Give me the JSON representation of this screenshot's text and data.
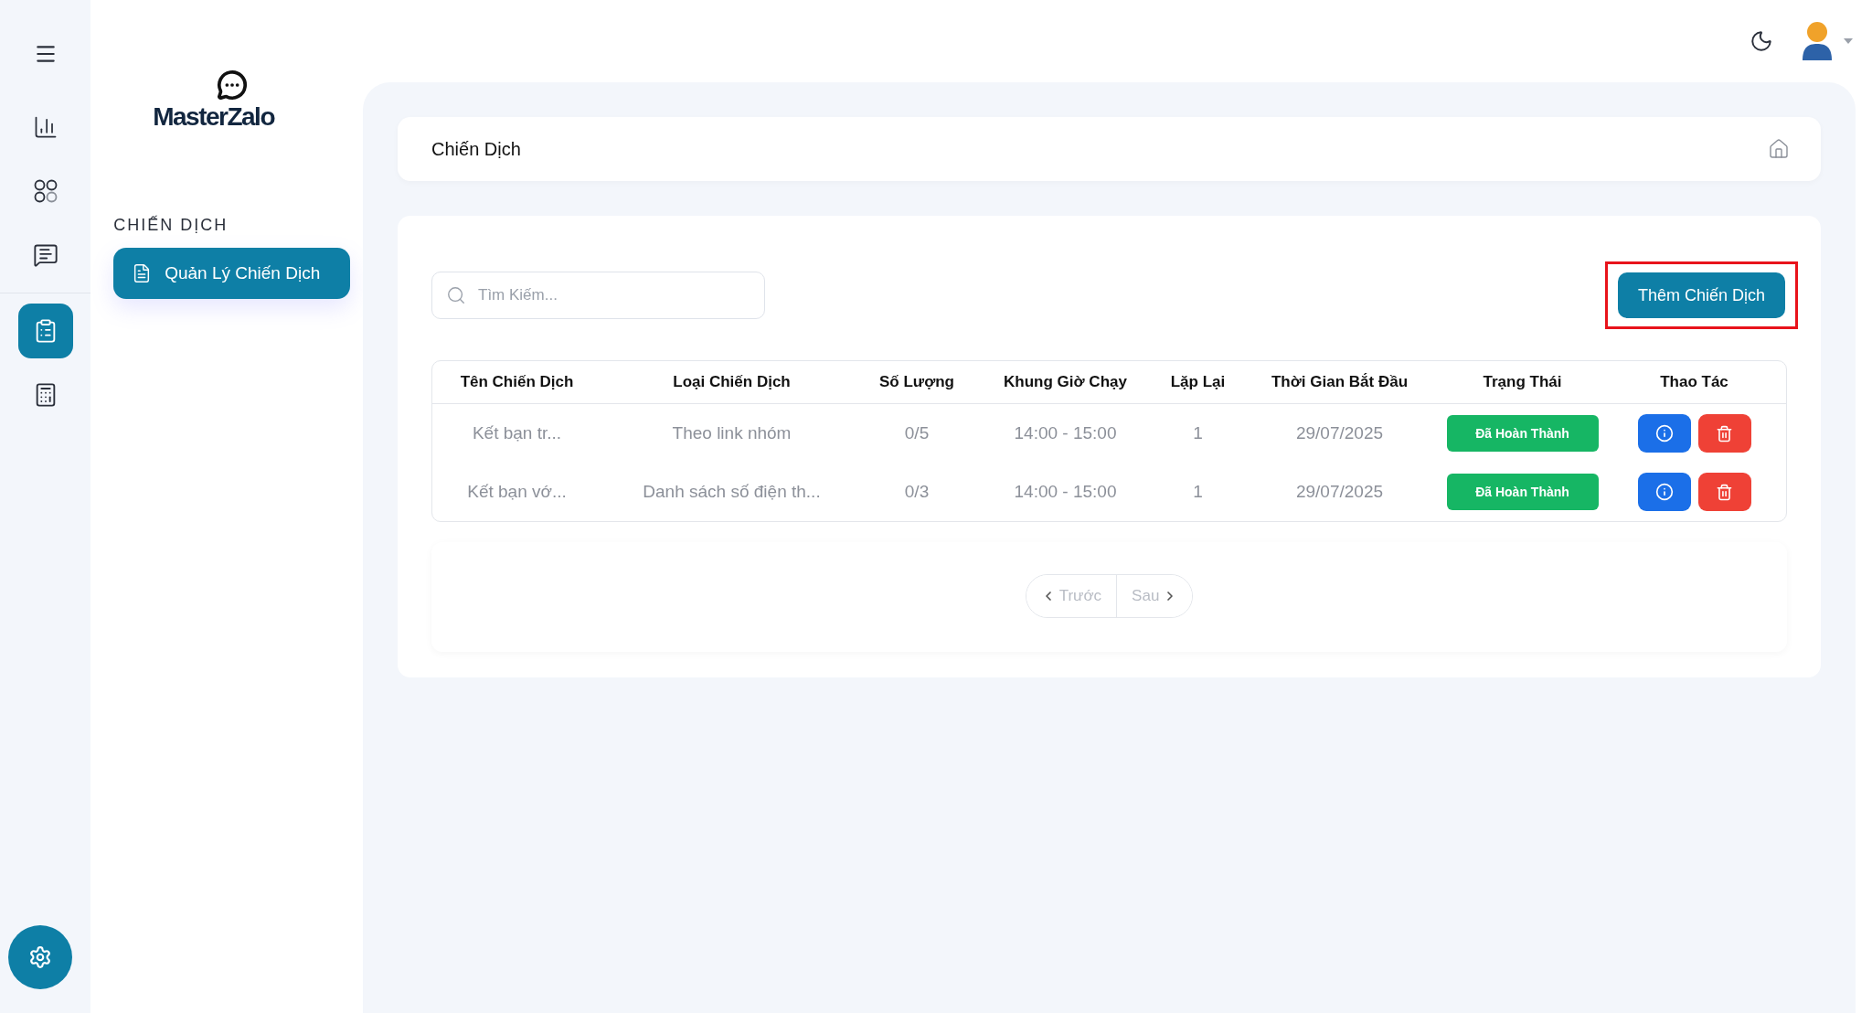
{
  "rail": {
    "items": [
      {
        "kind": "menu",
        "selected": false
      },
      {
        "kind": "chart",
        "selected": false
      },
      {
        "kind": "apps",
        "selected": false
      },
      {
        "kind": "chat",
        "selected": false
      },
      {
        "kind": "clipboard",
        "selected": true
      },
      {
        "kind": "calculator",
        "selected": false
      }
    ],
    "settings": {
      "kind": "settings"
    }
  },
  "sidebar": {
    "logo": "MasterZalo",
    "section": "CHIẾN DỊCH",
    "items": [
      {
        "label": "Quản Lý Chiến Dịch",
        "selected": true
      }
    ]
  },
  "header": {
    "title": "Chiến Dịch"
  },
  "toolbar": {
    "search": {
      "placeholder": "Tìm Kiếm..."
    },
    "add_button": {
      "label": "Thêm Chiến Dịch",
      "highlighted": true
    }
  },
  "table": {
    "columns": [
      "Tên Chiến Dịch",
      "Loại Chiến Dịch",
      "Số Lượng",
      "Khung Giờ Chạy",
      "Lặp Lại",
      "Thời Gian Bắt Đầu",
      "Trạng Thái",
      "Thao Tác"
    ],
    "rows": [
      {
        "name": "Kết bạn tr...",
        "type": "Theo link nhóm",
        "count": "0/5",
        "time_window": "14:00 - 15:00",
        "repeat": "1",
        "start": "29/07/2025",
        "status": "Đã Hoàn Thành"
      },
      {
        "name": "Kết bạn vớ...",
        "type": "Danh sách số điện th...",
        "count": "0/3",
        "time_window": "14:00 - 15:00",
        "repeat": "1",
        "start": "29/07/2025",
        "status": "Đã Hoàn Thành"
      }
    ]
  },
  "pagination": {
    "prev": {
      "label": "Trước",
      "disabled": true
    },
    "next": {
      "label": "Sau",
      "disabled": true
    }
  }
}
